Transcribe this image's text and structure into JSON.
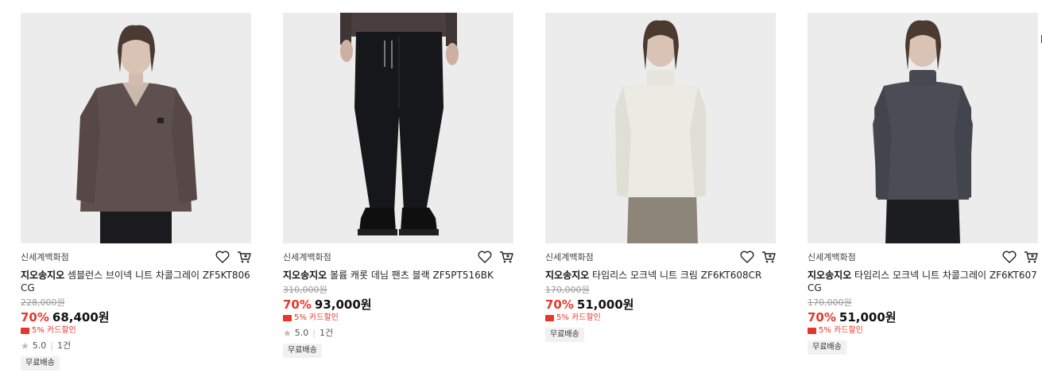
{
  "products": [
    {
      "store": "신세계백화점",
      "brand": "지오송지오",
      "name": "셈블런스 브이넥 니트 차콜그레이 ZF5KT806CG",
      "original_price": "228,000원",
      "discount": "70%",
      "price": "68,400원",
      "card_sale": "5% 카드할인",
      "rating": "5.0",
      "reviews": "1건",
      "shipping": "무료배송",
      "image": "model in charcoal brown v-neck knit",
      "colors": {
        "bg": "#ececec",
        "garment": "#5d504e"
      }
    },
    {
      "store": "신세계백화점",
      "brand": "지오송지오",
      "name": "볼륨 캐롯 데님 팬츠 블랙 ZF5PT516BK",
      "original_price": "310,000원",
      "discount": "70%",
      "price": "93,000원",
      "card_sale": "5% 카드할인",
      "rating": "5.0",
      "reviews": "1건",
      "shipping": "무료배송",
      "image": "black carrot denim pants",
      "colors": {
        "bg": "#ececec",
        "garment": "#16171b"
      }
    },
    {
      "store": "신세계백화점",
      "brand": "지오송지오",
      "name": "타임리스 모크넥 니트 크림 ZF6KT608CR",
      "original_price": "170,000원",
      "discount": "70%",
      "price": "51,000원",
      "card_sale": "5% 카드할인",
      "shipping": "무료배송",
      "image": "model in cream mock-neck knit",
      "colors": {
        "bg": "#ececec",
        "garment": "#ecebe3"
      }
    },
    {
      "store": "신세계백화점",
      "brand": "지오송지오",
      "name": "타임리스 모크넥 니트 차콜그레이 ZF6KT607CG",
      "original_price": "170,000원",
      "discount": "70%",
      "price": "51,000원",
      "card_sale": "5% 카드할인",
      "shipping": "무료배송",
      "image": "model in charcoal grey mock-neck knit",
      "colors": {
        "bg": "#ececec",
        "garment": "#4a4d55"
      }
    }
  ]
}
